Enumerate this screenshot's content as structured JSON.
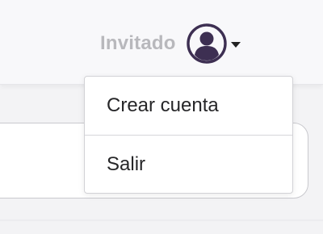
{
  "header": {
    "user_name": "Invitado",
    "avatar_icon": "user-circle-icon",
    "caret_icon": "caret-down-icon",
    "avatar_color": "#3d2f52"
  },
  "dropdown": {
    "items": [
      {
        "label": "Crear cuenta"
      },
      {
        "label": "Salir"
      }
    ]
  }
}
